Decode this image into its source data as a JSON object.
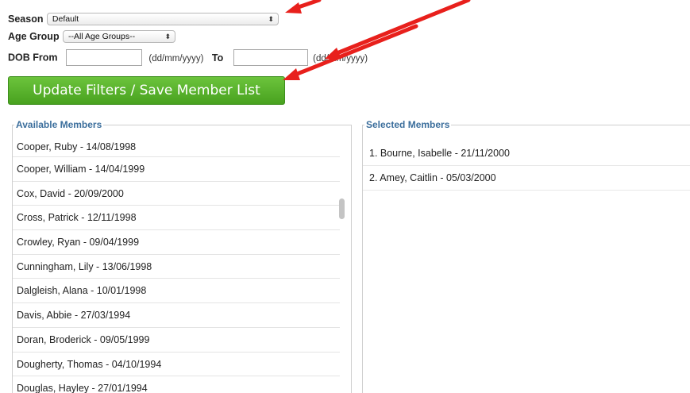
{
  "filters": {
    "season_label": "Season",
    "season_value": "Default",
    "age_group_label": "Age Group",
    "age_group_value": "--All Age Groups--",
    "dob_from_label": "DOB From",
    "dob_from_value": "",
    "dob_format_hint": "(dd/mm/yyyy)",
    "to_label": "To",
    "dob_to_value": "",
    "dob_to_format_hint": "(dd/mm/yyyy)"
  },
  "update_button": "Update Filters / Save Member List",
  "available": {
    "legend": "Available Members",
    "items": [
      "Cooper, Ruby - 14/08/1998",
      "Cooper, William - 14/04/1999",
      "Cox, David - 20/09/2000",
      "Cross, Patrick - 12/11/1998",
      "Crowley, Ryan - 09/04/1999",
      "Cunningham, Lily - 13/06/1998",
      "Dalgleish, Alana - 10/01/1998",
      "Davis, Abbie - 27/03/1994",
      "Doran, Broderick - 09/05/1999",
      "Dougherty, Thomas - 04/10/1994",
      "Douglas, Hayley - 27/01/1994"
    ]
  },
  "selected": {
    "legend": "Selected Members",
    "items": [
      "1. Bourne, Isabelle - 21/11/2000",
      "2. Amey, Caitlin - 05/03/2000"
    ]
  },
  "colors": {
    "button_green": "#52a927",
    "legend_blue": "#3b6e9c",
    "annotation_red": "#e8201c"
  }
}
